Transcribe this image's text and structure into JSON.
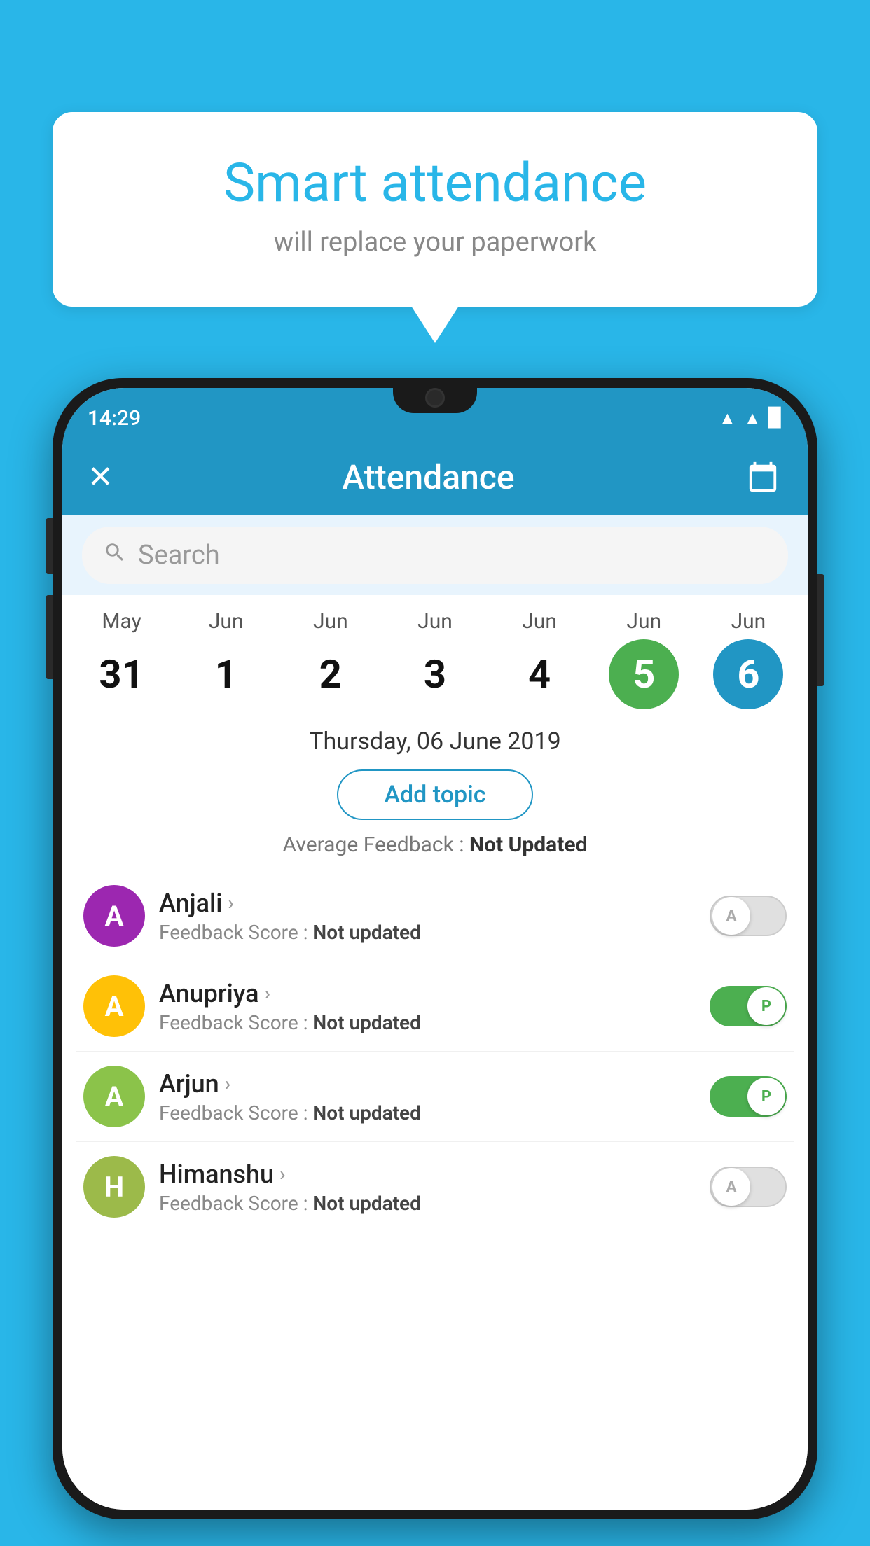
{
  "background_color": "#29b6e8",
  "speech_bubble": {
    "title": "Smart attendance",
    "subtitle": "will replace your paperwork"
  },
  "status_bar": {
    "time": "14:29",
    "wifi": "▲",
    "signal": "▲",
    "battery": "▉"
  },
  "app_bar": {
    "title": "Attendance",
    "close_label": "✕",
    "calendar_label": "📅"
  },
  "search": {
    "placeholder": "Search"
  },
  "dates": [
    {
      "month": "May",
      "day": "31",
      "state": "normal"
    },
    {
      "month": "Jun",
      "day": "1",
      "state": "normal"
    },
    {
      "month": "Jun",
      "day": "2",
      "state": "normal"
    },
    {
      "month": "Jun",
      "day": "3",
      "state": "normal"
    },
    {
      "month": "Jun",
      "day": "4",
      "state": "normal"
    },
    {
      "month": "Jun",
      "day": "5",
      "state": "today"
    },
    {
      "month": "Jun",
      "day": "6",
      "state": "selected"
    }
  ],
  "selected_date": "Thursday, 06 June 2019",
  "add_topic_label": "Add topic",
  "avg_feedback": {
    "label": "Average Feedback : ",
    "value": "Not Updated"
  },
  "students": [
    {
      "name": "Anjali",
      "avatar_letter": "A",
      "avatar_color": "purple",
      "feedback_label": "Feedback Score : ",
      "feedback_value": "Not updated",
      "toggle_state": "off",
      "toggle_letter": "A"
    },
    {
      "name": "Anupriya",
      "avatar_letter": "A",
      "avatar_color": "yellow",
      "feedback_label": "Feedback Score : ",
      "feedback_value": "Not updated",
      "toggle_state": "on",
      "toggle_letter": "P"
    },
    {
      "name": "Arjun",
      "avatar_letter": "A",
      "avatar_color": "green",
      "feedback_label": "Feedback Score : ",
      "feedback_value": "Not updated",
      "toggle_state": "on",
      "toggle_letter": "P"
    },
    {
      "name": "Himanshu",
      "avatar_letter": "H",
      "avatar_color": "olive",
      "feedback_label": "Feedback Score : ",
      "feedback_value": "Not updated",
      "toggle_state": "off",
      "toggle_letter": "A"
    }
  ]
}
